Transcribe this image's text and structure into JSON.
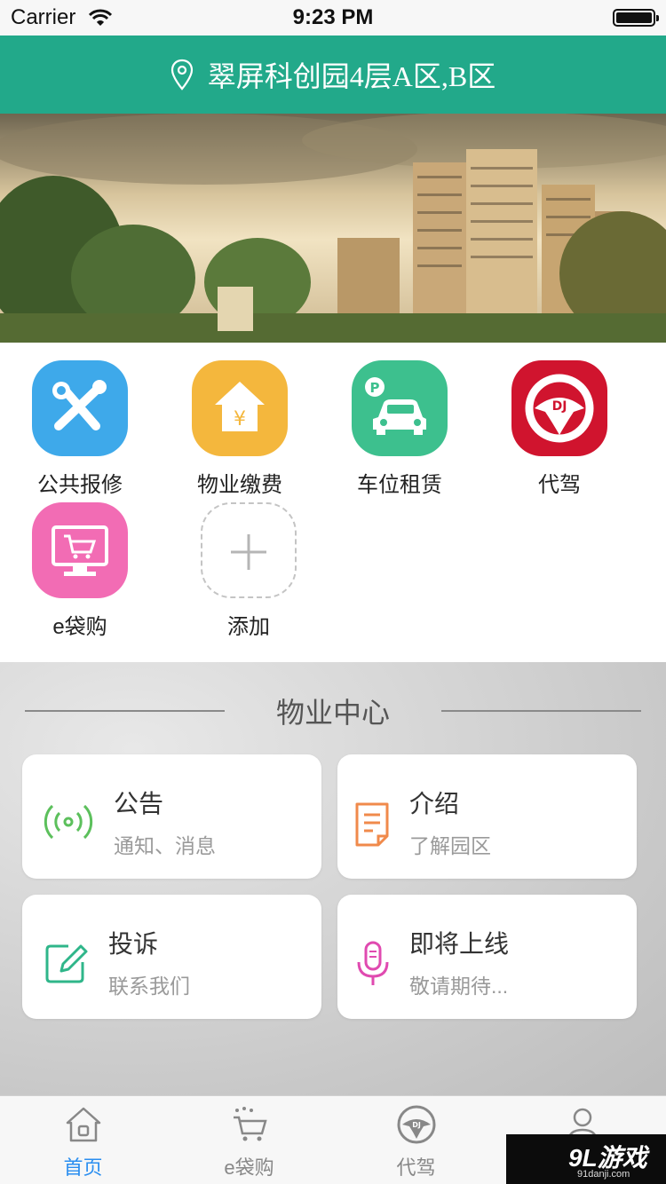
{
  "status_bar": {
    "carrier": "Carrier",
    "time": "9:23 PM"
  },
  "header": {
    "title": "翠屏科创园4层A区,B区",
    "location_icon": "location-pin-icon"
  },
  "colors": {
    "header": "#22a98a",
    "active_tab": "#2a8ef0"
  },
  "services": [
    {
      "label": "公共报修",
      "icon": "tools-icon",
      "color": "#3ea9ea"
    },
    {
      "label": "物业缴费",
      "icon": "house-yen-icon",
      "color": "#f4b73d"
    },
    {
      "label": "车位租赁",
      "icon": "parking-car-icon",
      "color": "#3dc08e"
    },
    {
      "label": "代驾",
      "icon": "steering-wheel-dj-icon",
      "color": "#d0142e"
    },
    {
      "label": "e袋购",
      "icon": "shopping-cart-screen-icon",
      "color": "#f26cb4"
    },
    {
      "label": "添加",
      "icon": "add-icon"
    }
  ],
  "center": {
    "title": "物业中心",
    "cards": [
      {
        "title": "公告",
        "subtitle": "通知、消息",
        "icon": "broadcast-icon"
      },
      {
        "title": "介绍",
        "subtitle": "了解园区",
        "icon": "document-icon"
      },
      {
        "title": "投诉",
        "subtitle": "联系我们",
        "icon": "edit-icon"
      },
      {
        "title": "即将上线",
        "subtitle": "敬请期待...",
        "icon": "microphone-icon"
      }
    ]
  },
  "tabbar": {
    "tabs": [
      {
        "label": "首页",
        "icon": "home-icon"
      },
      {
        "label": "e袋购",
        "icon": "cart-icon"
      },
      {
        "label": "代驾",
        "icon": "steering-wheel-icon"
      },
      {
        "label": "",
        "icon": "profile-icon"
      }
    ],
    "active_index": 0
  },
  "watermark": {
    "mark": "9L游戏",
    "site": "91danji.com"
  }
}
